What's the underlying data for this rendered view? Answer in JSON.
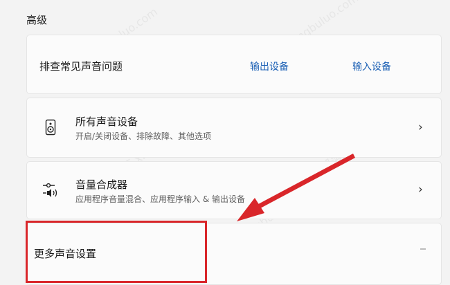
{
  "section": {
    "title": "高级"
  },
  "troubleshoot": {
    "label": "排查常见声音问题",
    "output_link": "输出设备",
    "input_link": "输入设备"
  },
  "all_devices": {
    "label": "所有声音设备",
    "description": "开启/关闭设备、排除故障、其他选项",
    "icon": "speaker-icon"
  },
  "volume_mixer": {
    "label": "音量合成器",
    "description": "应用程序音量混合、应用程序输入 & 输出设备",
    "icon": "volume-mixer-icon"
  },
  "more_settings": {
    "label": "更多声音设置"
  },
  "annotation": {
    "highlight_color": "#d9262a"
  }
}
